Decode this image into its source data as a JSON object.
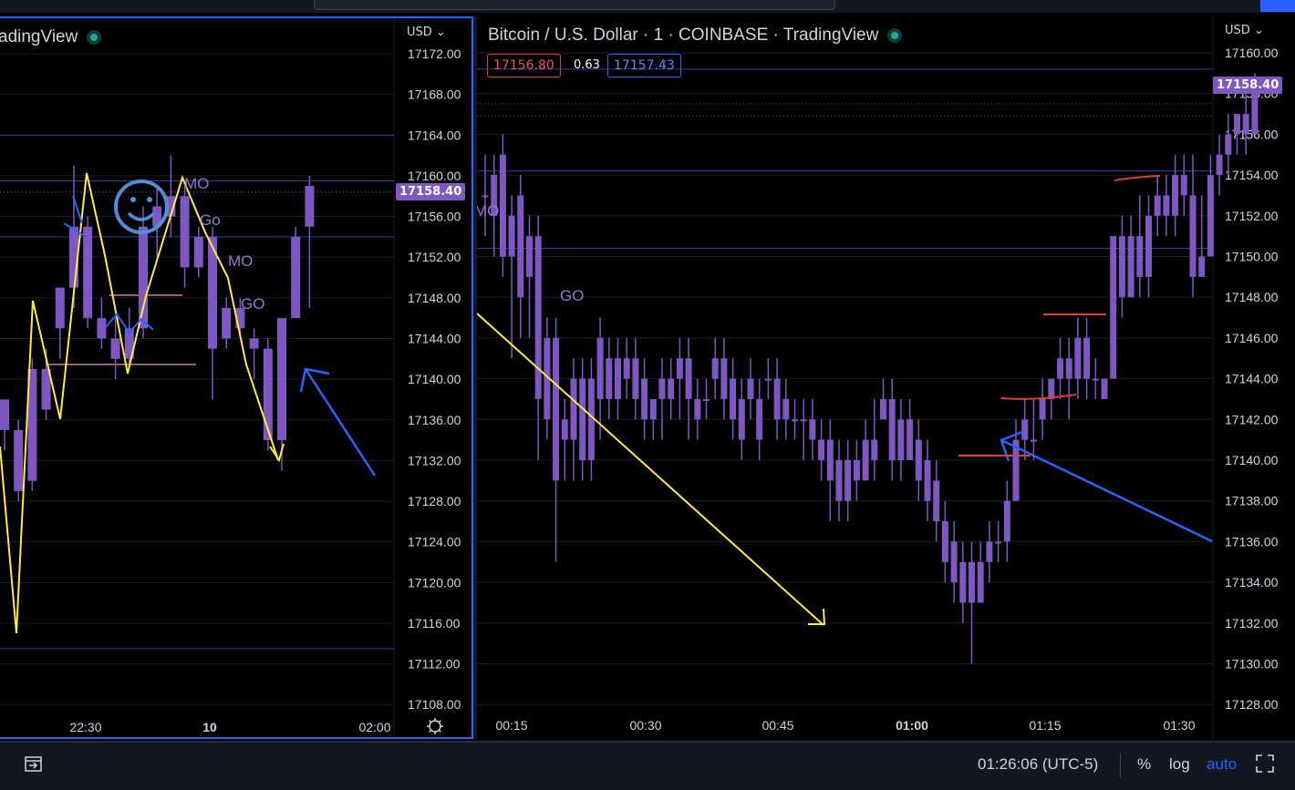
{
  "colors": {
    "candle": "#7e57c2",
    "hline": "#2f3ea8",
    "grid": "#1a1d26",
    "yellow": "#ffeb3b",
    "blue": "#2962ff",
    "red": "#e53935",
    "accent": "#2962ff"
  },
  "left_pane": {
    "title": "adingView",
    "currency": "USD",
    "currency_chevron": "chevron-down-icon",
    "price_label": "17158.40",
    "y_ticks": [
      "17172.00",
      "17168.00",
      "17164.00",
      "17160.00",
      "17156.00",
      "17152.00",
      "17148.00",
      "17144.00",
      "17140.00",
      "17136.00",
      "17132.00",
      "17128.00",
      "17124.00",
      "17120.00",
      "17116.00",
      "17112.00",
      "17108.00"
    ],
    "x_ticks": [
      "22:30",
      "10",
      "02:00"
    ],
    "annotations": [
      "MO",
      "Go",
      "MO",
      "GO"
    ],
    "settings_icon": "gear-icon"
  },
  "right_pane": {
    "title": "Bitcoin / U.S. Dollar · 1 · COINBASE · TradingView",
    "currency": "USD",
    "bid": "17156.80",
    "spread": "0.63",
    "ask": "17157.43",
    "price_label": "17158.40",
    "y_ticks": [
      "17160.00",
      "17158.00",
      "17156.00",
      "17154.00",
      "17152.00",
      "17150.00",
      "17148.00",
      "17146.00",
      "17144.00",
      "17142.00",
      "17140.00",
      "17138.00",
      "17136.00",
      "17134.00",
      "17132.00",
      "17130.00",
      "17128.00"
    ],
    "x_ticks": [
      "00:15",
      "00:30",
      "00:45",
      "01:00",
      "01:15",
      "01:30"
    ],
    "annotations": [
      "GO",
      "MO"
    ]
  },
  "bottom_bar": {
    "clock": "01:26:06 (UTC-5)",
    "percent": "%",
    "log": "log",
    "auto": "auto",
    "date_range_icon": "date-range-icon",
    "fullscreen_icon": "fullscreen-icon"
  },
  "chart_data": [
    {
      "type": "candlestick",
      "title": "",
      "ylim": [
        17106,
        17174
      ],
      "x_ticks": [
        "22:30",
        "10",
        "02:00"
      ],
      "candles": [
        {
          "o": 17138,
          "h": 17138,
          "c": 17135,
          "l": 17133
        },
        {
          "o": 17135,
          "h": 17136,
          "c": 17129,
          "l": 17128
        },
        {
          "o": 17130,
          "h": 17142,
          "c": 17141,
          "l": 17129
        },
        {
          "o": 17141,
          "h": 17143,
          "c": 17137,
          "l": 17136
        },
        {
          "o": 17145,
          "h": 17149,
          "c": 17149,
          "l": 17142
        },
        {
          "o": 17149,
          "h": 17161,
          "c": 17155,
          "l": 17147
        },
        {
          "o": 17155,
          "h": 17156,
          "c": 17146,
          "l": 17145
        },
        {
          "o": 17146,
          "h": 17148,
          "c": 17144,
          "l": 17143
        },
        {
          "o": 17144,
          "h": 17146,
          "c": 17142,
          "l": 17140
        },
        {
          "o": 17142,
          "h": 17147,
          "c": 17145,
          "l": 17141
        },
        {
          "o": 17145,
          "h": 17157,
          "c": 17155,
          "l": 17144
        },
        {
          "o": 17155,
          "h": 17159,
          "c": 17157,
          "l": 17152
        },
        {
          "o": 17156,
          "h": 17162,
          "c": 17158,
          "l": 17154
        },
        {
          "o": 17158,
          "h": 17159,
          "c": 17151,
          "l": 17149
        },
        {
          "o": 17154,
          "h": 17155,
          "c": 17151,
          "l": 17150
        },
        {
          "o": 17154,
          "h": 17155,
          "c": 17143,
          "l": 17138
        },
        {
          "o": 17147,
          "h": 17148,
          "c": 17144,
          "l": 17143
        },
        {
          "o": 17147,
          "h": 17148,
          "c": 17145,
          "l": 17144
        },
        {
          "o": 17144,
          "h": 17145,
          "c": 17143,
          "l": 17140
        },
        {
          "o": 17143,
          "h": 17144,
          "c": 17134,
          "l": 17133
        },
        {
          "o": 17134,
          "h": 17146,
          "c": 17146,
          "l": 17131
        },
        {
          "o": 17146,
          "h": 17155,
          "c": 17154,
          "l": 17147
        },
        {
          "o": 17155,
          "h": 17160,
          "c": 17159,
          "l": 17147
        }
      ]
    },
    {
      "type": "candlestick",
      "title": "",
      "ylim": [
        17127,
        17161
      ],
      "x_ticks": [
        "00:15",
        "00:30",
        "00:45",
        "01:00",
        "01:15",
        "01:30"
      ],
      "candles": [
        {
          "o": 17153,
          "h": 17155,
          "c": 17153,
          "l": 17151
        },
        {
          "o": 17154,
          "h": 17155,
          "c": 17152,
          "l": 17150
        },
        {
          "o": 17155,
          "h": 17156,
          "c": 17150,
          "l": 17149
        },
        {
          "o": 17152,
          "h": 17153,
          "c": 17150,
          "l": 17145
        },
        {
          "o": 17153,
          "h": 17154,
          "c": 17148,
          "l": 17146
        },
        {
          "o": 17151,
          "h": 17152,
          "c": 17149,
          "l": 17146
        },
        {
          "o": 17151,
          "h": 17152,
          "c": 17143,
          "l": 17140
        },
        {
          "o": 17146,
          "h": 17147,
          "c": 17142,
          "l": 17141
        },
        {
          "o": 17146,
          "h": 17147,
          "c": 17139,
          "l": 17135
        },
        {
          "o": 17142,
          "h": 17143,
          "c": 17141,
          "l": 17139
        },
        {
          "o": 17144,
          "h": 17145,
          "c": 17141,
          "l": 17139
        },
        {
          "o": 17144,
          "h": 17145,
          "c": 17140,
          "l": 17139
        },
        {
          "o": 17144,
          "h": 17145,
          "c": 17140,
          "l": 17139
        },
        {
          "o": 17146,
          "h": 17147,
          "c": 17143,
          "l": 17141
        },
        {
          "o": 17145,
          "h": 17146,
          "c": 17143,
          "l": 17142
        },
        {
          "o": 17145,
          "h": 17146,
          "c": 17143,
          "l": 17142
        },
        {
          "o": 17145,
          "h": 17146,
          "c": 17144,
          "l": 17143
        },
        {
          "o": 17145,
          "h": 17146,
          "c": 17143,
          "l": 17142
        },
        {
          "o": 17144,
          "h": 17145,
          "c": 17142,
          "l": 17141
        },
        {
          "o": 17142,
          "h": 17143,
          "c": 17143,
          "l": 17141
        },
        {
          "o": 17144,
          "h": 17145,
          "c": 17143,
          "l": 17141
        },
        {
          "o": 17144,
          "h": 17145,
          "c": 17143,
          "l": 17142
        },
        {
          "o": 17145,
          "h": 17146,
          "c": 17144,
          "l": 17142
        },
        {
          "o": 17145,
          "h": 17146,
          "c": 17143,
          "l": 17141
        },
        {
          "o": 17143,
          "h": 17144,
          "c": 17142,
          "l": 17141
        },
        {
          "o": 17143,
          "h": 17144,
          "c": 17143,
          "l": 17142
        },
        {
          "o": 17145,
          "h": 17146,
          "c": 17144,
          "l": 17143
        },
        {
          "o": 17145,
          "h": 17146,
          "c": 17143,
          "l": 17142
        },
        {
          "o": 17144,
          "h": 17145,
          "c": 17142,
          "l": 17141
        },
        {
          "o": 17143,
          "h": 17144,
          "c": 17141,
          "l": 17140
        },
        {
          "o": 17144,
          "h": 17145,
          "c": 17143,
          "l": 17142
        },
        {
          "o": 17143,
          "h": 17144,
          "c": 17141,
          "l": 17140
        },
        {
          "o": 17144,
          "h": 17145,
          "c": 17144,
          "l": 17143
        },
        {
          "o": 17144,
          "h": 17145,
          "c": 17142,
          "l": 17141
        },
        {
          "o": 17143,
          "h": 17144,
          "c": 17142,
          "l": 17141
        },
        {
          "o": 17142,
          "h": 17143,
          "c": 17142,
          "l": 17141
        },
        {
          "o": 17142,
          "h": 17143,
          "c": 17142,
          "l": 17140
        },
        {
          "o": 17142,
          "h": 17143,
          "c": 17141,
          "l": 17140
        },
        {
          "o": 17141,
          "h": 17142,
          "c": 17140,
          "l": 17139
        },
        {
          "o": 17141,
          "h": 17142,
          "c": 17139,
          "l": 17137
        },
        {
          "o": 17140,
          "h": 17141,
          "c": 17138,
          "l": 17137
        },
        {
          "o": 17140,
          "h": 17141,
          "c": 17138,
          "l": 17137
        },
        {
          "o": 17140,
          "h": 17141,
          "c": 17139,
          "l": 17138
        },
        {
          "o": 17141,
          "h": 17142,
          "c": 17139,
          "l": 17139
        },
        {
          "o": 17141,
          "h": 17143,
          "c": 17140,
          "l": 17139
        },
        {
          "o": 17142,
          "h": 17144,
          "c": 17143,
          "l": 17142
        },
        {
          "o": 17143,
          "h": 17144,
          "c": 17140,
          "l": 17139
        },
        {
          "o": 17142,
          "h": 17143,
          "c": 17140,
          "l": 17139
        },
        {
          "o": 17142,
          "h": 17143,
          "c": 17140,
          "l": 17140
        },
        {
          "o": 17141,
          "h": 17142,
          "c": 17139,
          "l": 17138
        },
        {
          "o": 17140,
          "h": 17141,
          "c": 17138,
          "l": 17137
        },
        {
          "o": 17139,
          "h": 17140,
          "c": 17137,
          "l": 17136
        },
        {
          "o": 17137,
          "h": 17138,
          "c": 17135,
          "l": 17134
        },
        {
          "o": 17136,
          "h": 17137,
          "c": 17134,
          "l": 17133
        },
        {
          "o": 17135,
          "h": 17136,
          "c": 17133,
          "l": 17132
        },
        {
          "o": 17135,
          "h": 17136,
          "c": 17133,
          "l": 17130
        },
        {
          "o": 17135,
          "h": 17136,
          "c": 17133,
          "l": 17133
        },
        {
          "o": 17136,
          "h": 17137,
          "c": 17135,
          "l": 17134
        },
        {
          "o": 17136,
          "h": 17137,
          "c": 17136,
          "l": 17135
        },
        {
          "o": 17136,
          "h": 17139,
          "c": 17138,
          "l": 17135
        },
        {
          "o": 17138,
          "h": 17142,
          "c": 17141,
          "l": 17138
        },
        {
          "o": 17141,
          "h": 17143,
          "c": 17142,
          "l": 17140
        },
        {
          "o": 17141,
          "h": 17143,
          "c": 17141,
          "l": 17140
        },
        {
          "o": 17142,
          "h": 17144,
          "c": 17143,
          "l": 17141
        },
        {
          "o": 17143,
          "h": 17144,
          "c": 17144,
          "l": 17142
        },
        {
          "o": 17144,
          "h": 17146,
          "c": 17145,
          "l": 17143
        },
        {
          "o": 17145,
          "h": 17146,
          "c": 17144,
          "l": 17142
        },
        {
          "o": 17144,
          "h": 17147,
          "c": 17146,
          "l": 17143
        },
        {
          "o": 17146,
          "h": 17147,
          "c": 17144,
          "l": 17143
        },
        {
          "o": 17144,
          "h": 17145,
          "c": 17144,
          "l": 17143
        },
        {
          "o": 17143,
          "h": 17144,
          "c": 17144,
          "l": 17143
        },
        {
          "o": 17144,
          "h": 17151,
          "c": 17151,
          "l": 17144
        },
        {
          "o": 17151,
          "h": 17152,
          "c": 17148,
          "l": 17147
        },
        {
          "o": 17148,
          "h": 17152,
          "c": 17151,
          "l": 17148
        },
        {
          "o": 17151,
          "h": 17153,
          "c": 17149,
          "l": 17148
        },
        {
          "o": 17149,
          "h": 17153,
          "c": 17152,
          "l": 17148
        },
        {
          "o": 17152,
          "h": 17154,
          "c": 17153,
          "l": 17151
        },
        {
          "o": 17153,
          "h": 17154,
          "c": 17152,
          "l": 17151
        },
        {
          "o": 17152,
          "h": 17155,
          "c": 17154,
          "l": 17151
        },
        {
          "o": 17154,
          "h": 17155,
          "c": 17153,
          "l": 17152
        },
        {
          "o": 17153,
          "h": 17155,
          "c": 17149,
          "l": 17148
        },
        {
          "o": 17149,
          "h": 17153,
          "c": 17150,
          "l": 17149
        },
        {
          "o": 17150,
          "h": 17155,
          "c": 17154,
          "l": 17150
        },
        {
          "o": 17154,
          "h": 17156,
          "c": 17155,
          "l": 17153
        },
        {
          "o": 17155,
          "h": 17157,
          "c": 17156,
          "l": 17154
        },
        {
          "o": 17156,
          "h": 17157,
          "c": 17157,
          "l": 17155
        },
        {
          "o": 17157,
          "h": 17158,
          "c": 17156,
          "l": 17155
        },
        {
          "o": 17156,
          "h": 17159,
          "c": 17158,
          "l": 17156
        }
      ]
    }
  ]
}
